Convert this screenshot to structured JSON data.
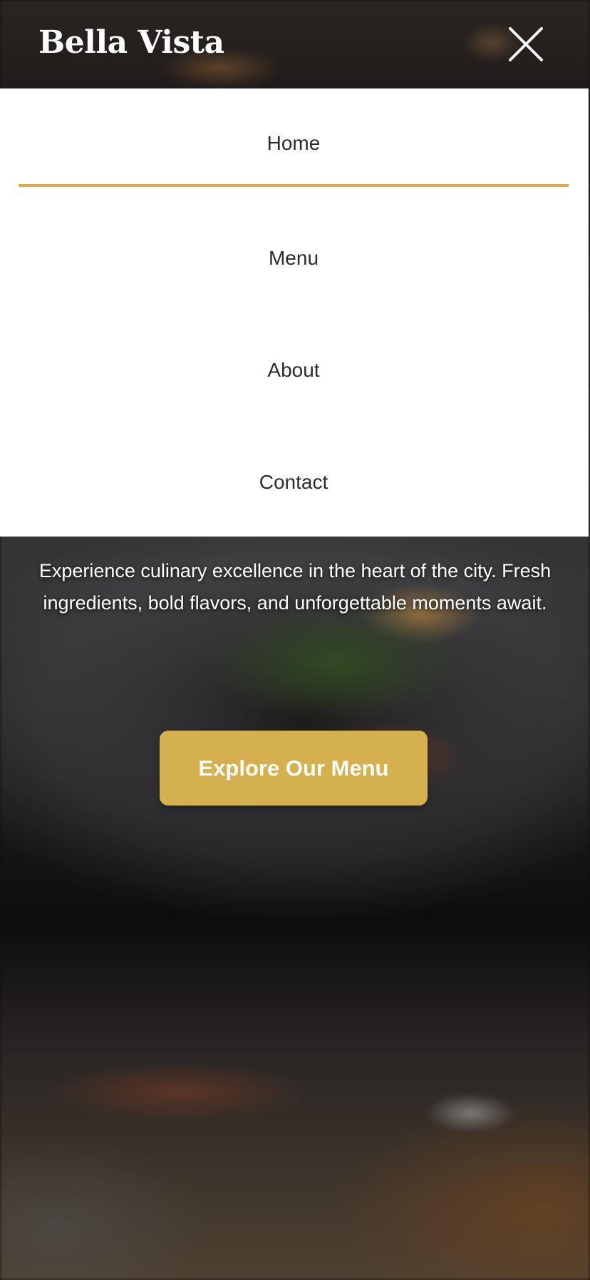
{
  "brand": {
    "name": "Bella Vista"
  },
  "header": {
    "close_icon": "close-icon"
  },
  "nav": {
    "items": [
      {
        "label": "Home",
        "active": true
      },
      {
        "label": "Menu",
        "active": false
      },
      {
        "label": "About",
        "active": false
      },
      {
        "label": "Contact",
        "active": false
      }
    ]
  },
  "hero": {
    "tagline": "Experience culinary excellence in the heart of the city. Fresh ingredients, bold flavors, and unforgettable moments await.",
    "cta_label": "Explore Our Menu"
  },
  "colors": {
    "accent": "#d4b04e",
    "nav_text": "#2c2c2c",
    "panel_bg": "#ffffff"
  }
}
